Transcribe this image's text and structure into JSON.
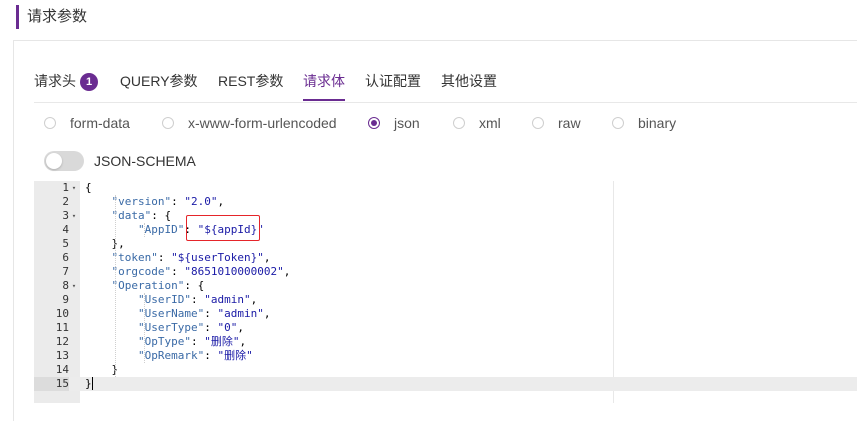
{
  "section": {
    "title": "请求参数"
  },
  "tabs": [
    {
      "label": "请求头",
      "badge": "1"
    },
    {
      "label": "QUERY参数"
    },
    {
      "label": "REST参数"
    },
    {
      "label": "请求体",
      "active": true
    },
    {
      "label": "认证配置"
    },
    {
      "label": "其他设置"
    }
  ],
  "body_types": [
    {
      "label": "form-data",
      "checked": false
    },
    {
      "label": "x-www-form-urlencoded",
      "checked": false
    },
    {
      "label": "json",
      "checked": true
    },
    {
      "label": "xml",
      "checked": false
    },
    {
      "label": "raw",
      "checked": false
    },
    {
      "label": "binary",
      "checked": false
    }
  ],
  "json_schema_toggle": {
    "label": "JSON-SCHEMA",
    "on": false
  },
  "editor": {
    "lines": [
      {
        "num": "1",
        "fold": "▾",
        "text": "{"
      },
      {
        "num": "2",
        "fold": "",
        "text": "    \"version\": \"2.0\","
      },
      {
        "num": "3",
        "fold": "▾",
        "text": "    \"data\": {"
      },
      {
        "num": "4",
        "fold": "",
        "text": "        \"AppID\": \"${appId}\""
      },
      {
        "num": "5",
        "fold": "",
        "text": "    },"
      },
      {
        "num": "6",
        "fold": "",
        "text": "    \"token\": \"${userToken}\","
      },
      {
        "num": "7",
        "fold": "",
        "text": "    \"orgcode\": \"8651010000002\","
      },
      {
        "num": "8",
        "fold": "▾",
        "text": "    \"Operation\": {"
      },
      {
        "num": "9",
        "fold": "",
        "text": "        \"UserID\": \"admin\","
      },
      {
        "num": "10",
        "fold": "",
        "text": "        \"UserName\": \"admin\","
      },
      {
        "num": "11",
        "fold": "",
        "text": "        \"UserType\": \"0\","
      },
      {
        "num": "12",
        "fold": "",
        "text": "        \"OpType\": \"删除\","
      },
      {
        "num": "13",
        "fold": "",
        "text": "        \"OpRemark\": \"删除\""
      },
      {
        "num": "14",
        "fold": "",
        "text": "    }"
      },
      {
        "num": "15",
        "fold": "",
        "text": "}"
      }
    ],
    "active_line": "15"
  },
  "colors": {
    "accent": "#6a2c91",
    "highlight_box": "#e5252a",
    "json_key": "#3a6aa6",
    "json_string": "#1a1aa6"
  }
}
